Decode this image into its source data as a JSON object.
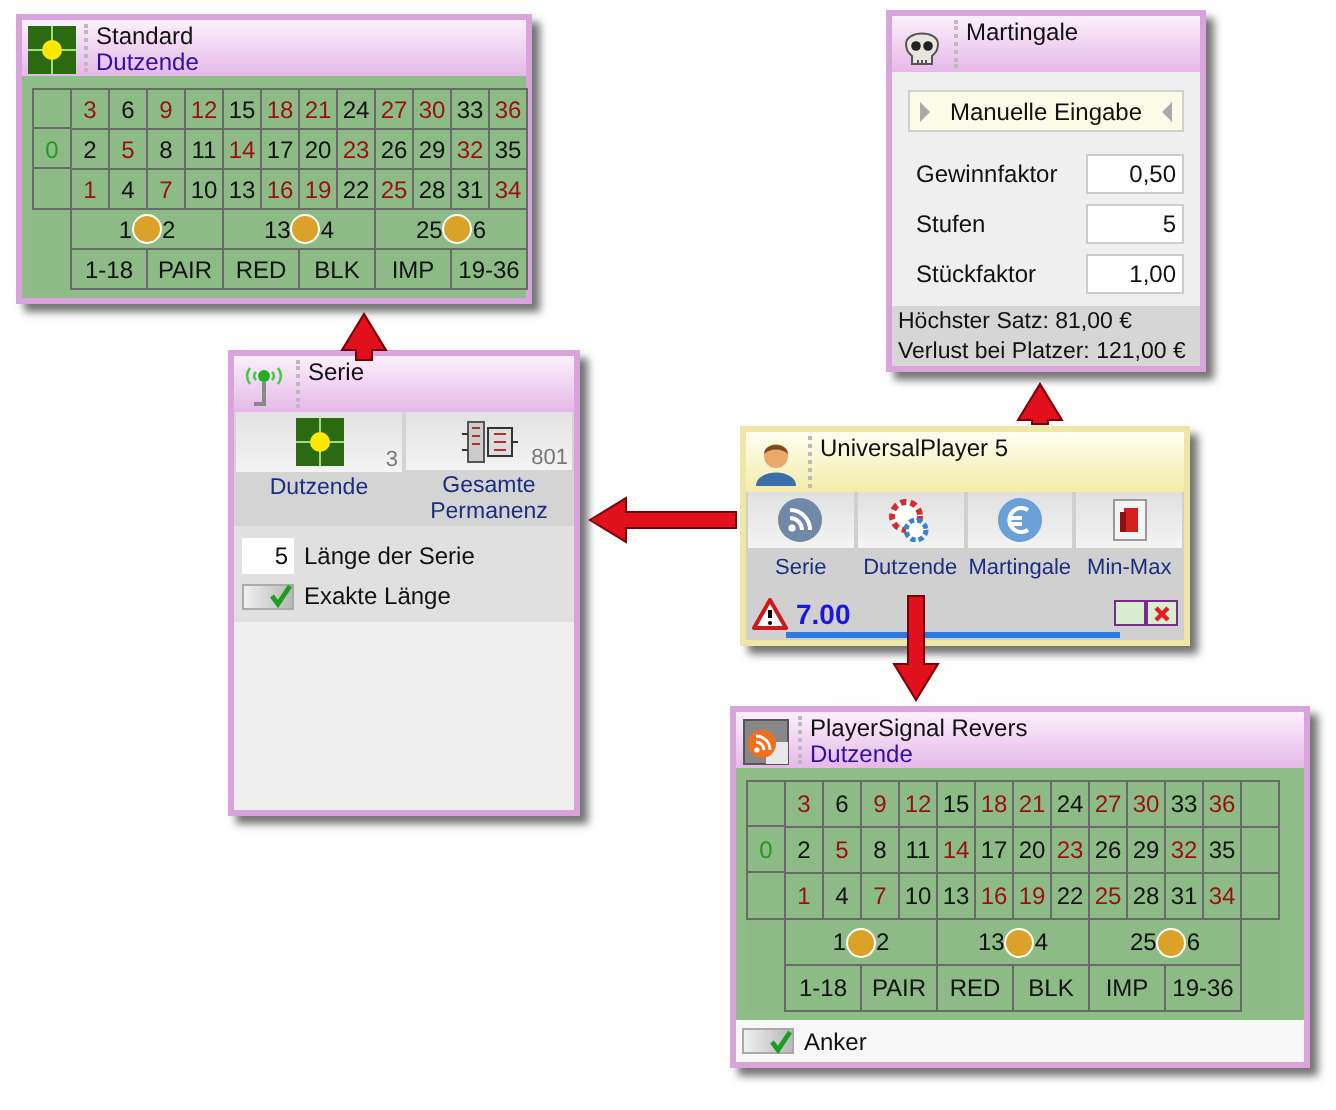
{
  "standard": {
    "title": "Standard",
    "subtitle": "Dutzende",
    "table": {
      "extra_column": false,
      "zero": {
        "text": "0",
        "color": "#1e9a1e"
      },
      "rows": [
        [
          {
            "text": "3",
            "color": "#9a1010"
          },
          {
            "text": "6",
            "color": "#111111"
          },
          {
            "text": "9",
            "color": "#9a1010"
          },
          {
            "text": "12",
            "color": "#9a1010"
          },
          {
            "text": "15",
            "color": "#111111"
          },
          {
            "text": "18",
            "color": "#9a1010"
          },
          {
            "text": "21",
            "color": "#9a1010"
          },
          {
            "text": "24",
            "color": "#111111"
          },
          {
            "text": "27",
            "color": "#9a1010"
          },
          {
            "text": "30",
            "color": "#9a1010"
          },
          {
            "text": "33",
            "color": "#111111"
          },
          {
            "text": "36",
            "color": "#9a1010"
          }
        ],
        [
          {
            "text": "2",
            "color": "#111111"
          },
          {
            "text": "5",
            "color": "#9a1010"
          },
          {
            "text": "8",
            "color": "#111111"
          },
          {
            "text": "11",
            "color": "#111111"
          },
          {
            "text": "14",
            "color": "#9a1010"
          },
          {
            "text": "17",
            "color": "#111111"
          },
          {
            "text": "20",
            "color": "#111111"
          },
          {
            "text": "23",
            "color": "#9a1010"
          },
          {
            "text": "26",
            "color": "#111111"
          },
          {
            "text": "29",
            "color": "#111111"
          },
          {
            "text": "32",
            "color": "#9a1010"
          },
          {
            "text": "35",
            "color": "#111111"
          }
        ],
        [
          {
            "text": "1",
            "color": "#9a1010"
          },
          {
            "text": "4",
            "color": "#111111"
          },
          {
            "text": "7",
            "color": "#9a1010"
          },
          {
            "text": "10",
            "color": "#111111"
          },
          {
            "text": "13",
            "color": "#111111"
          },
          {
            "text": "16",
            "color": "#9a1010"
          },
          {
            "text": "19",
            "color": "#9a1010"
          },
          {
            "text": "22",
            "color": "#111111"
          },
          {
            "text": "25",
            "color": "#9a1010"
          },
          {
            "text": "28",
            "color": "#111111"
          },
          {
            "text": "31",
            "color": "#111111"
          },
          {
            "text": "34",
            "color": "#9a1010"
          }
        ]
      ],
      "dozens": [
        {
          "parts": [
            "1",
            "2"
          ],
          "chip": true
        },
        {
          "parts": [
            "13",
            "4"
          ],
          "chip": true
        },
        {
          "parts": [
            "25",
            "6"
          ],
          "chip": true
        }
      ],
      "outside": [
        "1-18",
        "PAIR",
        "RED",
        "BLK",
        "IMP",
        "19-36"
      ]
    }
  },
  "martingale": {
    "title": "Martingale",
    "mode": "Manuelle Eingabe",
    "fields": [
      {
        "label": "Gewinnfaktor",
        "value": "0,50"
      },
      {
        "label": "Stufen",
        "value": "5"
      },
      {
        "label": "Stückfaktor",
        "value": "1,00"
      }
    ],
    "summary": [
      "Höchster Satz: 81,00 €",
      "Verlust bei Platzer: 121,00 €"
    ]
  },
  "serie": {
    "title": "Serie",
    "sources": [
      {
        "kind": "dozen",
        "label": "Dutzende",
        "count": "3"
      },
      {
        "kind": "device",
        "label": "Gesamte Permanenz",
        "count": "801"
      }
    ],
    "length": {
      "value": "5",
      "label": "Länge der Serie"
    },
    "exact": {
      "label": "Exakte Länge",
      "checked": true
    }
  },
  "player": {
    "title": "UniversalPlayer 5",
    "buttons": [
      {
        "kind": "rss",
        "label": "Serie"
      },
      {
        "kind": "chips",
        "label": "Dutzende"
      },
      {
        "kind": "euro",
        "label": "Martingale"
      },
      {
        "kind": "door",
        "label": "Min-Max"
      }
    ],
    "value": "7.00",
    "level": 1
  },
  "signal": {
    "title": "PlayerSignal Revers",
    "subtitle": "Dutzende",
    "table": {
      "extra_column": true,
      "zero": {
        "text": "0",
        "color": "#1e9a1e"
      },
      "rows": [
        [
          {
            "text": "3",
            "color": "#9a1010"
          },
          {
            "text": "6",
            "color": "#111111"
          },
          {
            "text": "9",
            "color": "#9a1010"
          },
          {
            "text": "12",
            "color": "#9a1010"
          },
          {
            "text": "15",
            "color": "#111111"
          },
          {
            "text": "18",
            "color": "#9a1010"
          },
          {
            "text": "21",
            "color": "#9a1010"
          },
          {
            "text": "24",
            "color": "#111111"
          },
          {
            "text": "27",
            "color": "#9a1010"
          },
          {
            "text": "30",
            "color": "#9a1010"
          },
          {
            "text": "33",
            "color": "#111111"
          },
          {
            "text": "36",
            "color": "#9a1010"
          }
        ],
        [
          {
            "text": "2",
            "color": "#111111"
          },
          {
            "text": "5",
            "color": "#9a1010"
          },
          {
            "text": "8",
            "color": "#111111"
          },
          {
            "text": "11",
            "color": "#111111"
          },
          {
            "text": "14",
            "color": "#9a1010"
          },
          {
            "text": "17",
            "color": "#111111"
          },
          {
            "text": "20",
            "color": "#111111"
          },
          {
            "text": "23",
            "color": "#9a1010"
          },
          {
            "text": "26",
            "color": "#111111"
          },
          {
            "text": "29",
            "color": "#111111"
          },
          {
            "text": "32",
            "color": "#9a1010"
          },
          {
            "text": "35",
            "color": "#111111"
          }
        ],
        [
          {
            "text": "1",
            "color": "#9a1010"
          },
          {
            "text": "4",
            "color": "#111111"
          },
          {
            "text": "7",
            "color": "#9a1010"
          },
          {
            "text": "10",
            "color": "#111111"
          },
          {
            "text": "13",
            "color": "#111111"
          },
          {
            "text": "16",
            "color": "#9a1010"
          },
          {
            "text": "19",
            "color": "#9a1010"
          },
          {
            "text": "22",
            "color": "#111111"
          },
          {
            "text": "25",
            "color": "#9a1010"
          },
          {
            "text": "28",
            "color": "#111111"
          },
          {
            "text": "31",
            "color": "#111111"
          },
          {
            "text": "34",
            "color": "#9a1010"
          }
        ]
      ],
      "dozens": [
        {
          "parts": [
            "1",
            "2"
          ],
          "chip": true
        },
        {
          "parts": [
            "13",
            "4"
          ],
          "chip": true
        },
        {
          "parts": [
            "25",
            "6"
          ],
          "chip": true
        }
      ],
      "outside": [
        "1-18",
        "PAIR",
        "RED",
        "BLK",
        "IMP",
        "19-36"
      ]
    },
    "anchor": {
      "label": "Anker",
      "checked": true
    }
  }
}
